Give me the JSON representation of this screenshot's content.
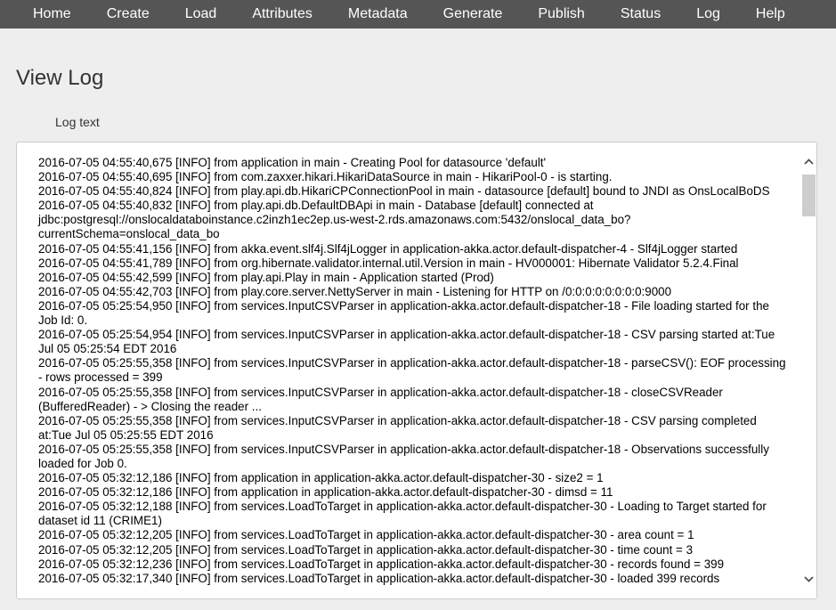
{
  "nav": {
    "items": [
      {
        "label": "Home"
      },
      {
        "label": "Create"
      },
      {
        "label": "Load"
      },
      {
        "label": "Attributes"
      },
      {
        "label": "Metadata"
      },
      {
        "label": "Generate"
      },
      {
        "label": "Publish"
      },
      {
        "label": "Status"
      },
      {
        "label": "Log"
      },
      {
        "label": "Help"
      }
    ]
  },
  "page": {
    "title": "View Log",
    "field_label": "Log text"
  },
  "log": {
    "lines": [
      "2016-07-05 04:55:40,675 [INFO] from application in main - Creating Pool for datasource 'default'",
      "2016-07-05 04:55:40,695 [INFO] from com.zaxxer.hikari.HikariDataSource in main - HikariPool-0 - is starting.",
      "2016-07-05 04:55:40,824 [INFO] from play.api.db.HikariCPConnectionPool in main - datasource [default] bound to JNDI as OnsLocalBoDS",
      "2016-07-05 04:55:40,832 [INFO] from play.api.db.DefaultDBApi in main - Database [default] connected at jdbc:postgresql://onslocaldataboinstance.c2inzh1ec2ep.us-west-2.rds.amazonaws.com:5432/onslocal_data_bo?currentSchema=onslocal_data_bo",
      "2016-07-05 04:55:41,156 [INFO] from akka.event.slf4j.Slf4jLogger in application-akka.actor.default-dispatcher-4 - Slf4jLogger started",
      "2016-07-05 04:55:41,789 [INFO] from org.hibernate.validator.internal.util.Version in main - HV000001: Hibernate Validator 5.2.4.Final",
      "2016-07-05 04:55:42,599 [INFO] from play.api.Play in main - Application started (Prod)",
      "2016-07-05 04:55:42,703 [INFO] from play.core.server.NettyServer in main - Listening for HTTP on /0:0:0:0:0:0:0:0:9000",
      "2016-07-05 05:25:54,950 [INFO] from services.InputCSVParser in application-akka.actor.default-dispatcher-18 - File loading started for the Job Id: 0.",
      "2016-07-05 05:25:54,954 [INFO] from services.InputCSVParser in application-akka.actor.default-dispatcher-18 - CSV parsing started at:Tue Jul 05 05:25:54 EDT 2016",
      "2016-07-05 05:25:55,358 [INFO] from services.InputCSVParser in application-akka.actor.default-dispatcher-18 - parseCSV(): EOF processing - rows processed = 399",
      "2016-07-05 05:25:55,358 [INFO] from services.InputCSVParser in application-akka.actor.default-dispatcher-18 - closeCSVReader (BufferedReader) - > Closing the reader ...",
      "2016-07-05 05:25:55,358 [INFO] from services.InputCSVParser in application-akka.actor.default-dispatcher-18 - CSV parsing completed at:Tue Jul 05 05:25:55 EDT 2016",
      "2016-07-05 05:25:55,358 [INFO] from services.InputCSVParser in application-akka.actor.default-dispatcher-18 - Observations successfully loaded for Job 0.",
      "2016-07-05 05:32:12,186 [INFO] from application in application-akka.actor.default-dispatcher-30 - size2 = 1",
      "2016-07-05 05:32:12,186 [INFO] from application in application-akka.actor.default-dispatcher-30 - dimsd = 11",
      "2016-07-05 05:32:12,188 [INFO] from services.LoadToTarget in application-akka.actor.default-dispatcher-30 - Loading to Target started for dataset id 11 (CRIME1)",
      "2016-07-05 05:32:12,205 [INFO] from services.LoadToTarget in application-akka.actor.default-dispatcher-30 - area count = 1",
      "2016-07-05 05:32:12,205 [INFO] from services.LoadToTarget in application-akka.actor.default-dispatcher-30 - time count =  3",
      "2016-07-05 05:32:12,236 [INFO] from services.LoadToTarget in application-akka.actor.default-dispatcher-30 - records found = 399",
      "2016-07-05 05:32:17,340 [INFO] from services.LoadToTarget in application-akka.actor.default-dispatcher-30 - loaded 399 records"
    ]
  },
  "scrollbar": {
    "up_icon": "chevron-up-icon",
    "down_icon": "chevron-down-icon",
    "thumb_color": "#cdcdcd"
  },
  "colors": {
    "navbar_bg": "#555555",
    "nav_text": "#ffffff",
    "page_bg": "#eeeeee",
    "log_bg": "#ffffff"
  }
}
